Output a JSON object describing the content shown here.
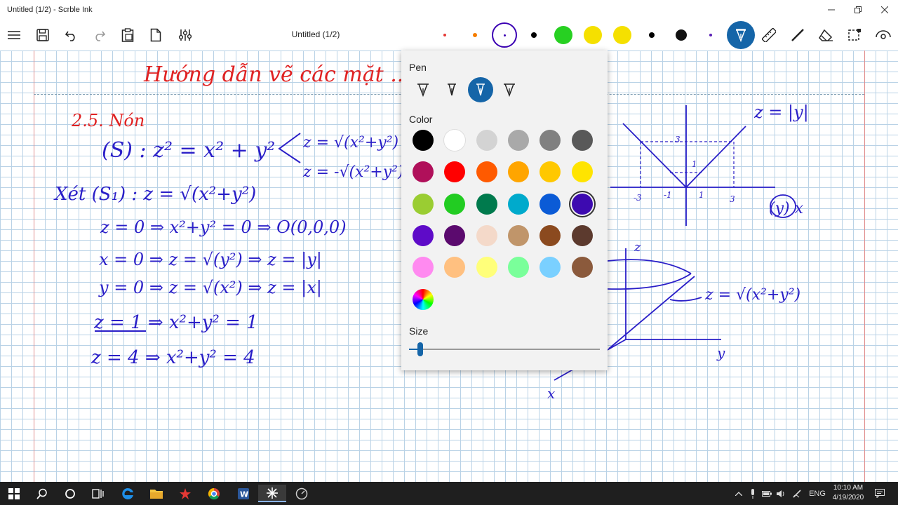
{
  "window": {
    "title": "Untitled (1/2) - Scrble Ink"
  },
  "toolbar": {
    "doc_title": "Untitled (1/2)",
    "icons": [
      "menu-icon",
      "save-icon",
      "undo-icon",
      "redo-icon",
      "clipboard-icon",
      "page-icon",
      "settings-sliders-icon"
    ],
    "right_icons": [
      "pen-icon",
      "ruler-icon",
      "line-icon",
      "eraser-icon",
      "lasso-select-icon",
      "view-icon"
    ],
    "pen_colors": [
      "#e53935",
      "#f57c00",
      "#3b00b3",
      "#000000",
      "#27d022",
      "#f5e000",
      "#f5e000",
      "#000000",
      "#111111",
      "#5a1fb5"
    ]
  },
  "popup": {
    "pen_label": "Pen",
    "color_label": "Color",
    "size_label": "Size",
    "size_value": 0.06,
    "pens": [
      "pen-tip-1-icon",
      "pen-tip-2-icon",
      "pen-tip-3-icon",
      "pen-tip-4-icon"
    ],
    "selected_pen": 2,
    "colors": [
      "#000000",
      "#ffffff",
      "#d3d3d3",
      "#a9a9a9",
      "#808080",
      "#595959",
      "#b0105a",
      "#ff0000",
      "#ff5a00",
      "#ffa500",
      "#ffc800",
      "#ffe400",
      "#9acd32",
      "#22cc22",
      "#007a4d",
      "#00aacc",
      "#0b5bd6",
      "#3d0ab0",
      "#5e0bc8",
      "#5b0a6e",
      "#f4d9c9",
      "#c0956a",
      "#8b4a1f",
      "#5c3a2e",
      "#ff8af0",
      "#ffc080",
      "#ffff7a",
      "#7aff9a",
      "#7ad0ff",
      "#8b5a3c"
    ],
    "selected_color": "#3d0ab0",
    "custom_color_icon": "color-wheel-icon"
  },
  "notes": {
    "heading": "Hướng dẫn vẽ các mặt ... ng (tiếp)",
    "section": "2.5. Nón",
    "lines": [
      "(S) : z² = x² + y²",
      "z = √(x²+y²)",
      "z = -√(x²+y²)",
      "Xét (S₁) : z = √(x²+y²)",
      "z = 0 ⇒ x²+y² = 0 ⇒ O(0,0,0)",
      "x = 0 ⇒ z = √(y²) ⇒ z = |y|",
      "y = 0 ⇒ z = √(x²) ⇒ z = |x|",
      "z = 1 ⇒ x²+y² = 1",
      "z = 4 ⇒ x²+y² = 4",
      "z = |y|",
      "(y) x",
      "z = √(x²+y²)",
      "z",
      "y",
      "x",
      "3",
      "1",
      "-3",
      "-1",
      "1",
      "3"
    ]
  },
  "taskbar": {
    "apps": [
      "windows-start-icon",
      "search-icon",
      "cortana-icon",
      "task-view-icon",
      "edge-icon",
      "file-explorer-icon",
      "app-red-icon",
      "chrome-icon",
      "word-icon",
      "scrble-ink-icon",
      "app-circle-icon"
    ],
    "tray_lang": "ENG",
    "time": "10:10 AM",
    "date": "4/19/2020"
  }
}
